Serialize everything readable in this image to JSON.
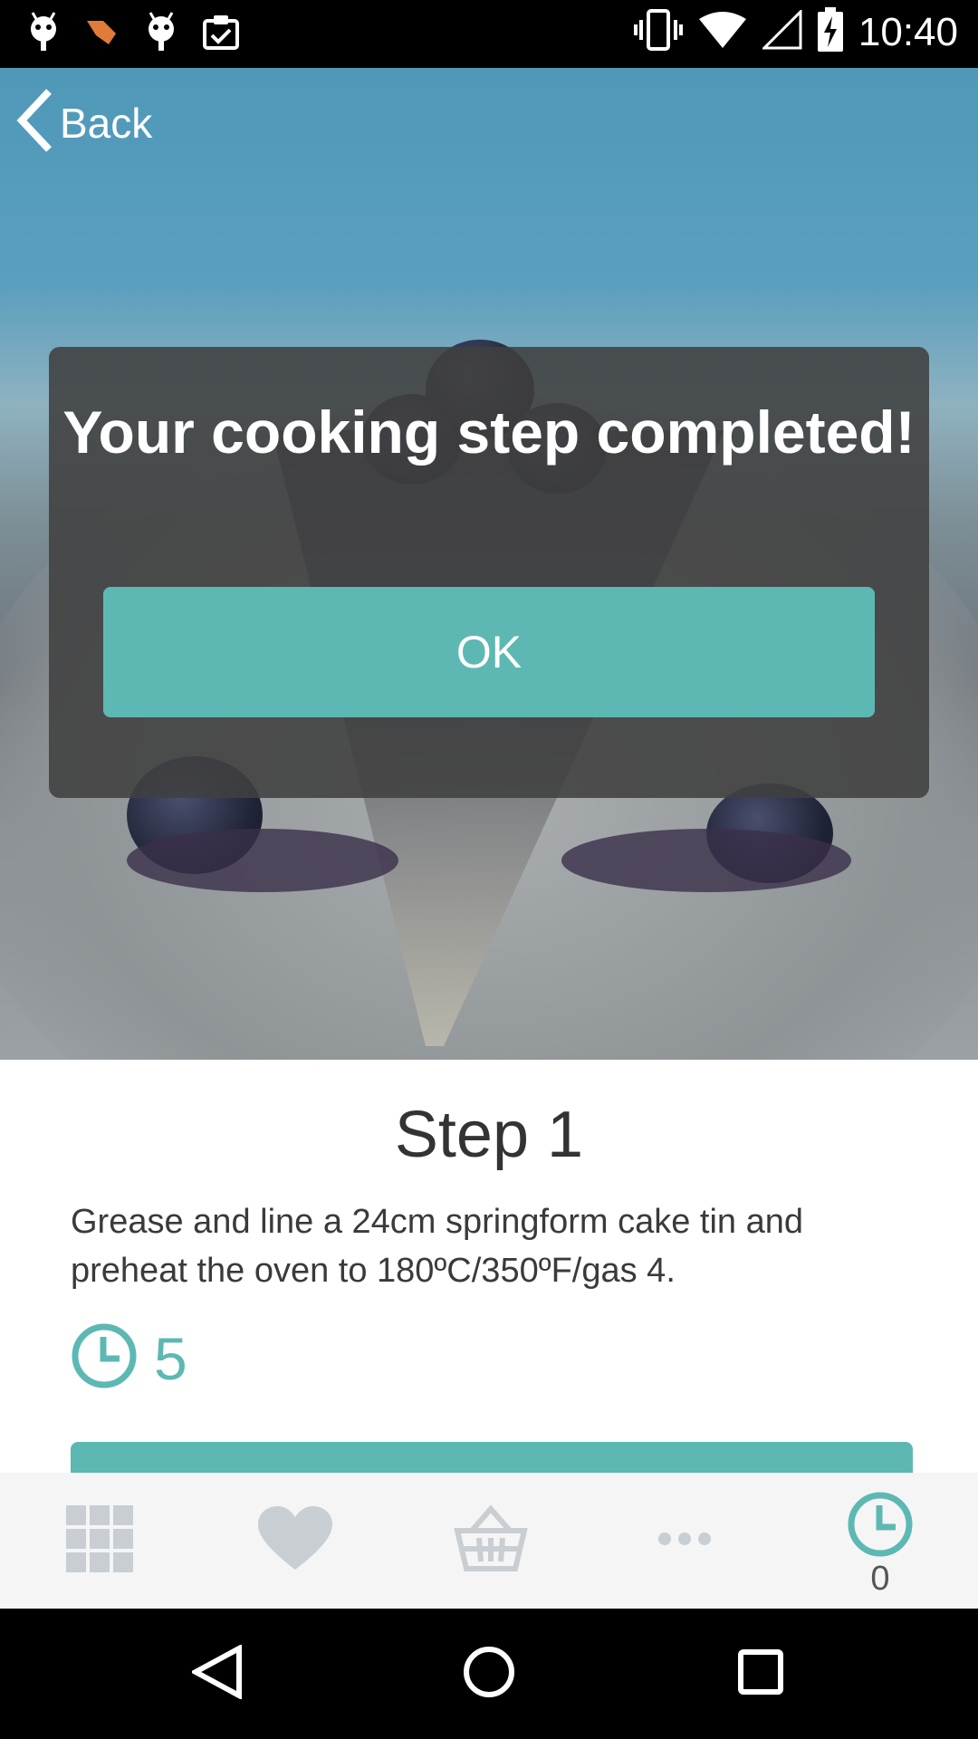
{
  "status_bar": {
    "time": "10:40",
    "icons_left": [
      "android-debug-icon",
      "touch-icon",
      "android-debug-icon",
      "clipboard-check-icon"
    ],
    "icons_right": [
      "vibrate-icon",
      "wifi-icon",
      "signal-icon",
      "battery-charging-icon"
    ]
  },
  "header": {
    "back_label": "Back",
    "back_icon": "chevron-left-icon"
  },
  "dialog": {
    "title": "Your cooking step completed!",
    "ok_label": "OK"
  },
  "step": {
    "title": "Step 1",
    "instructions": "Grease and line a 24cm springform cake tin and preheat the oven to 180ºC/350ºF/gas 4.",
    "time_icon": "clock-icon",
    "time_value": "5"
  },
  "tab_bar": {
    "items": [
      {
        "icon": "grid-icon",
        "active": false
      },
      {
        "icon": "heart-icon",
        "active": false
      },
      {
        "icon": "basket-icon",
        "active": false
      },
      {
        "icon": "more-icon",
        "active": false
      },
      {
        "icon": "clock-icon",
        "active": true,
        "count": "0"
      }
    ]
  },
  "colors": {
    "accent": "#5db8b3",
    "dialog_bg": "#404040",
    "tab_inactive": "#c9ced3",
    "tab_bar_bg": "#f5f5f5"
  },
  "nav_bar": {
    "buttons": [
      "back-triangle-icon",
      "home-circle-icon",
      "recents-square-icon"
    ]
  }
}
